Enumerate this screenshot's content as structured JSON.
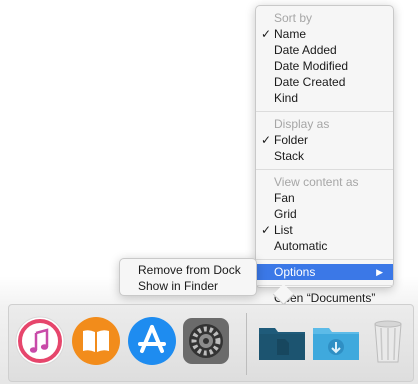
{
  "context_menu": {
    "sort_by": {
      "header": "Sort by",
      "items": [
        {
          "label": "Name",
          "checked": true
        },
        {
          "label": "Date Added",
          "checked": false
        },
        {
          "label": "Date Modified",
          "checked": false
        },
        {
          "label": "Date Created",
          "checked": false
        },
        {
          "label": "Kind",
          "checked": false
        }
      ]
    },
    "display_as": {
      "header": "Display as",
      "items": [
        {
          "label": "Folder",
          "checked": true
        },
        {
          "label": "Stack",
          "checked": false
        }
      ]
    },
    "view_content_as": {
      "header": "View content as",
      "items": [
        {
          "label": "Fan",
          "checked": false
        },
        {
          "label": "Grid",
          "checked": false
        },
        {
          "label": "List",
          "checked": true
        },
        {
          "label": "Automatic",
          "checked": false
        }
      ]
    },
    "options_label": "Options",
    "open_label": "Open “Documents”",
    "check_glyph": "✓",
    "submenu_arrow": "▶",
    "highlight_color": "#3b78e7"
  },
  "options_submenu": {
    "items": [
      "Remove from Dock",
      "Show in Finder"
    ]
  },
  "dock": {
    "apps": [
      {
        "icon": "itunes-icon",
        "color": "#e6466c"
      },
      {
        "icon": "ibooks-icon",
        "color": "#f28c1b"
      },
      {
        "icon": "app-store-icon",
        "color": "#1e8cf0"
      },
      {
        "icon": "system-preferences-icon",
        "color": "#5a5a5a"
      }
    ],
    "folders": [
      {
        "icon": "documents-folder-icon",
        "color": "#1f5b7a"
      },
      {
        "icon": "downloads-folder-icon",
        "color": "#3fa9dd"
      },
      {
        "icon": "trash-icon",
        "color": "#cfcfcf"
      }
    ]
  }
}
